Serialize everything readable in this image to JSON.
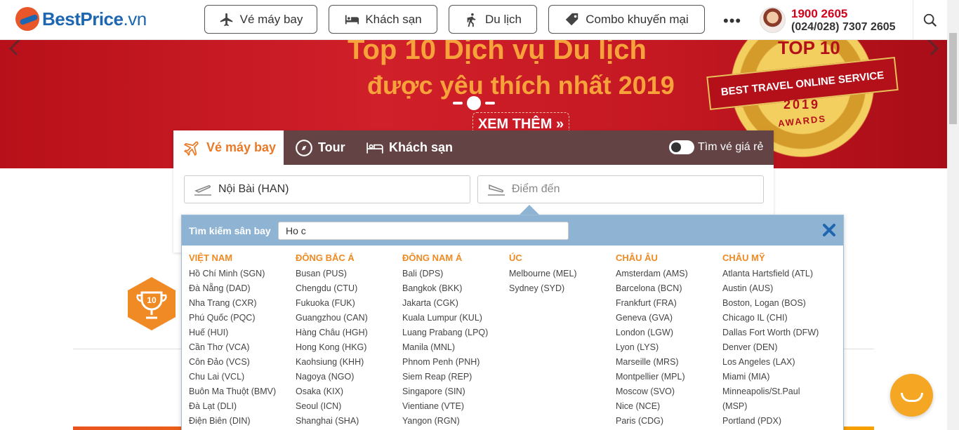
{
  "header": {
    "logo_text": "BestPrice",
    "logo_suffix": ".vn",
    "nav": [
      {
        "label": "Vé máy bay"
      },
      {
        "label": "Khách sạn"
      },
      {
        "label": "Du lịch"
      },
      {
        "label": "Combo khuyến mại"
      }
    ],
    "more": "•••",
    "phone_primary": "1900 2605",
    "phone_secondary": "(024/028) 7307 2605"
  },
  "banner": {
    "title": "Top 10 Dịch vụ Du lịch",
    "subtitle": "được yêu thích nhất 2019",
    "cta": "XEM THÊM »",
    "award_top": "TOP 10",
    "award_ribbon": "BEST TRAVEL ONLINE SERVICE",
    "award_year": "2019",
    "award_word": "AWARDS"
  },
  "search": {
    "tabs": [
      {
        "label": "Vé máy bay",
        "active": true
      },
      {
        "label": "Tour",
        "active": false
      },
      {
        "label": "Khách sạn",
        "active": false
      }
    ],
    "cheap_toggle_label": "Tìm vé giá rẻ",
    "origin_value": "Nội Bài (HAN)",
    "destination_placeholder": "Điểm đến"
  },
  "airport_dropdown": {
    "label": "Tìm kiếm sân bay",
    "query": "Ho c",
    "regions": [
      {
        "name": "VIỆT NAM",
        "airports": [
          "Hồ Chí Minh (SGN)",
          "Đà Nẵng (DAD)",
          "Nha Trang (CXR)",
          "Phú Quốc (PQC)",
          "Huế (HUI)",
          "Cần Thơ (VCA)",
          "Côn Đảo (VCS)",
          "Chu Lai (VCL)",
          "Buôn Ma Thuột (BMV)",
          "Đà Lạt (DLI)",
          "Điện Biên (DIN)"
        ]
      },
      {
        "name": "ĐÔNG BẮC Á",
        "airports": [
          "Busan (PUS)",
          "Chengdu (CTU)",
          "Fukuoka (FUK)",
          "Guangzhou (CAN)",
          "Hàng Châu (HGH)",
          "Hong Kong (HKG)",
          "Kaohsiung (KHH)",
          "Nagoya (NGO)",
          "Osaka (KIX)",
          "Seoul (ICN)",
          "Shanghai (SHA)"
        ]
      },
      {
        "name": "ĐÔNG NAM Á",
        "airports": [
          "Bali (DPS)",
          "Bangkok (BKK)",
          "Jakarta (CGK)",
          "Kuala Lumpur (KUL)",
          "Luang Prabang (LPQ)",
          "Manila (MNL)",
          "Phnom Penh (PNH)",
          "Siem Reap (REP)",
          "Singapore (SIN)",
          "Vientiane (VTE)",
          "Yangon (RGN)"
        ]
      },
      {
        "name": "ÚC",
        "airports": [
          "Melbourne (MEL)",
          "Sydney (SYD)"
        ]
      },
      {
        "name": "CHÂU ÂU",
        "airports": [
          "Amsterdam (AMS)",
          "Barcelona (BCN)",
          "Frankfurt (FRA)",
          "Geneva (GVA)",
          "London (LGW)",
          "Lyon (LYS)",
          "Marseille (MRS)",
          "Montpellier (MPL)",
          "Moscow (SVO)",
          "Nice (NCE)",
          "Paris (CDG)"
        ]
      },
      {
        "name": "CHÂU MỸ",
        "airports": [
          "Atlanta Hartsfield (ATL)",
          "Austin (AUS)",
          "Boston, Logan (BOS)",
          "Chicago IL (CHI)",
          "Dallas Fort Worth (DFW)",
          "Denver (DEN)",
          "Los Angeles (LAX)",
          "Miami (MIA)",
          "Minneapolis/St.Paul",
          "(MSP)",
          "Portland (PDX)"
        ]
      }
    ]
  },
  "colors": {
    "brand_blue": "#1d66b0",
    "brand_orange": "#e87a27",
    "banner_red": "#c41822",
    "dropdown_header": "#8fb3d2",
    "hotline_red": "#d0021b"
  }
}
